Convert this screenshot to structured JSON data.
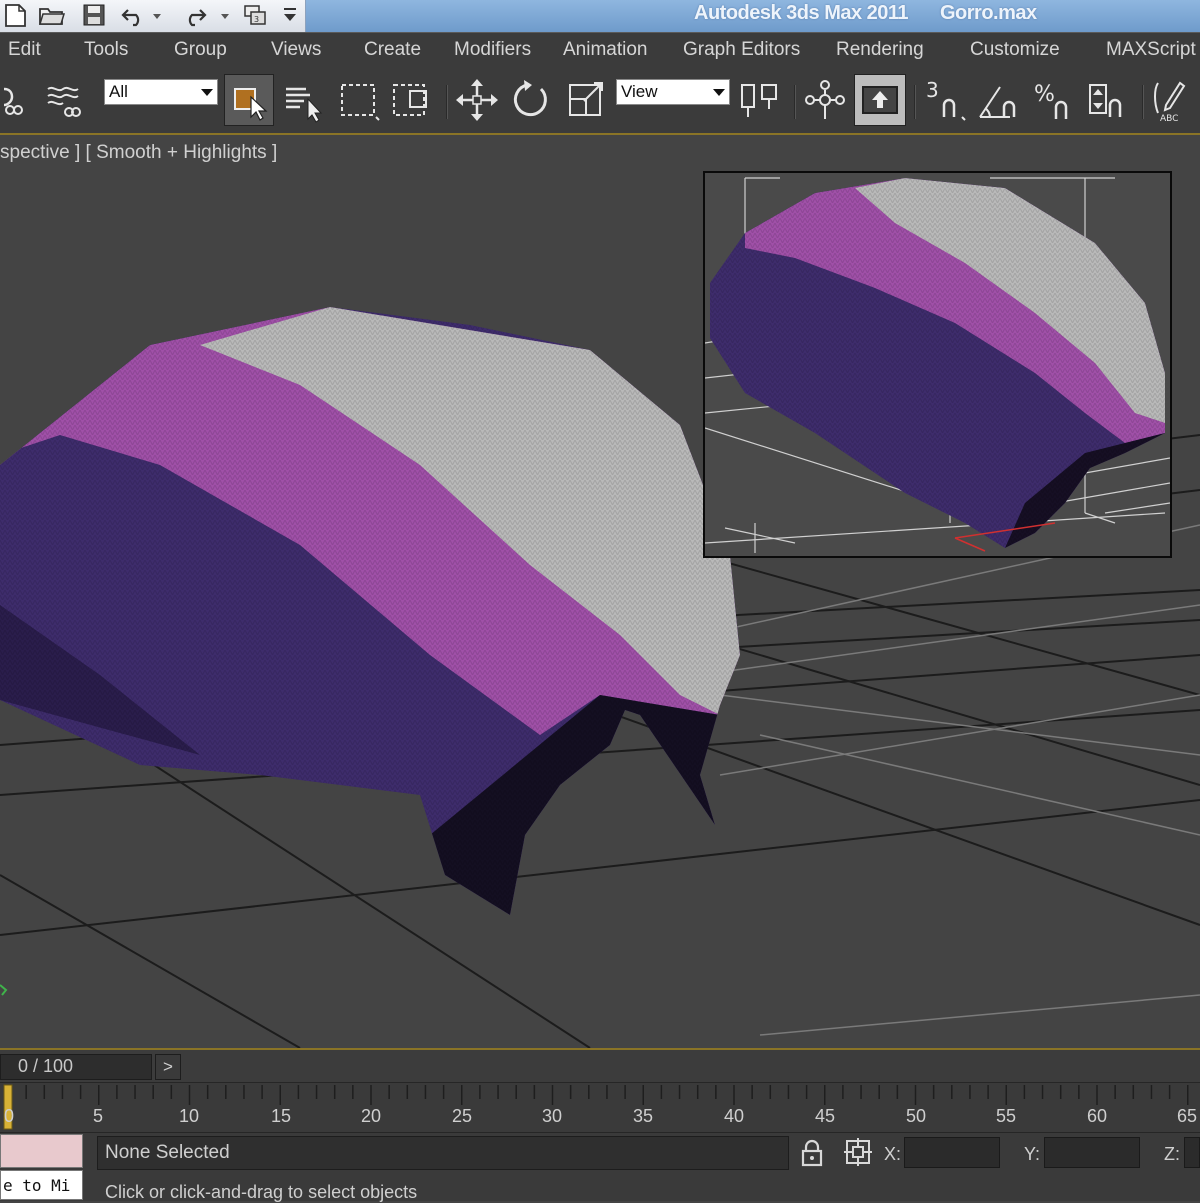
{
  "window": {
    "app_title": "Autodesk 3ds Max  2011",
    "file_name": "Gorro.max"
  },
  "menu": {
    "items": [
      "Edit",
      "Tools",
      "Group",
      "Views",
      "Create",
      "Modifiers",
      "Animation",
      "Graph Editors",
      "Rendering",
      "Customize",
      "MAXScript"
    ]
  },
  "toolbar": {
    "selection_filter": "All",
    "reference_coordinate": "View",
    "snap_3d_label": "3"
  },
  "viewport": {
    "label": "spective ] [ Smooth + Highlights ]"
  },
  "timeline": {
    "frame_display": "0 / 100",
    "next_label": ">",
    "ticks": [
      "0",
      "5",
      "10",
      "15",
      "20",
      "25",
      "30",
      "35",
      "40",
      "45",
      "50",
      "55",
      "60",
      "65"
    ]
  },
  "status": {
    "selection": "None Selected",
    "prompt": "Click or click-and-drag to select objects",
    "maxscript_text": "e to Mi",
    "x_label": "X:",
    "y_label": "Y:",
    "z_label": "Z:"
  },
  "colors": {
    "hat_top": "#b9b9b9",
    "hat_pink": "#a050a8",
    "hat_purple": "#3e2c6c",
    "ui_dark": "#3b3b3b",
    "accent_gold": "#8a7426"
  },
  "icons": [
    "new-icon",
    "open-icon",
    "save-icon",
    "undo-icon",
    "redo-icon",
    "project-icon",
    "link-icon",
    "unlink-icon",
    "select-object-icon",
    "select-by-name-icon",
    "rect-region-icon",
    "window-crossing-icon",
    "move-icon",
    "rotate-icon",
    "scale-icon",
    "pivot-icon",
    "manipulate-icon",
    "keyboard-shortcut-icon",
    "snap-3d-icon",
    "angle-snap-icon",
    "percent-snap-icon",
    "spinner-snap-icon",
    "named-selection-icon",
    "lock-icon",
    "absolute-mode-icon"
  ]
}
